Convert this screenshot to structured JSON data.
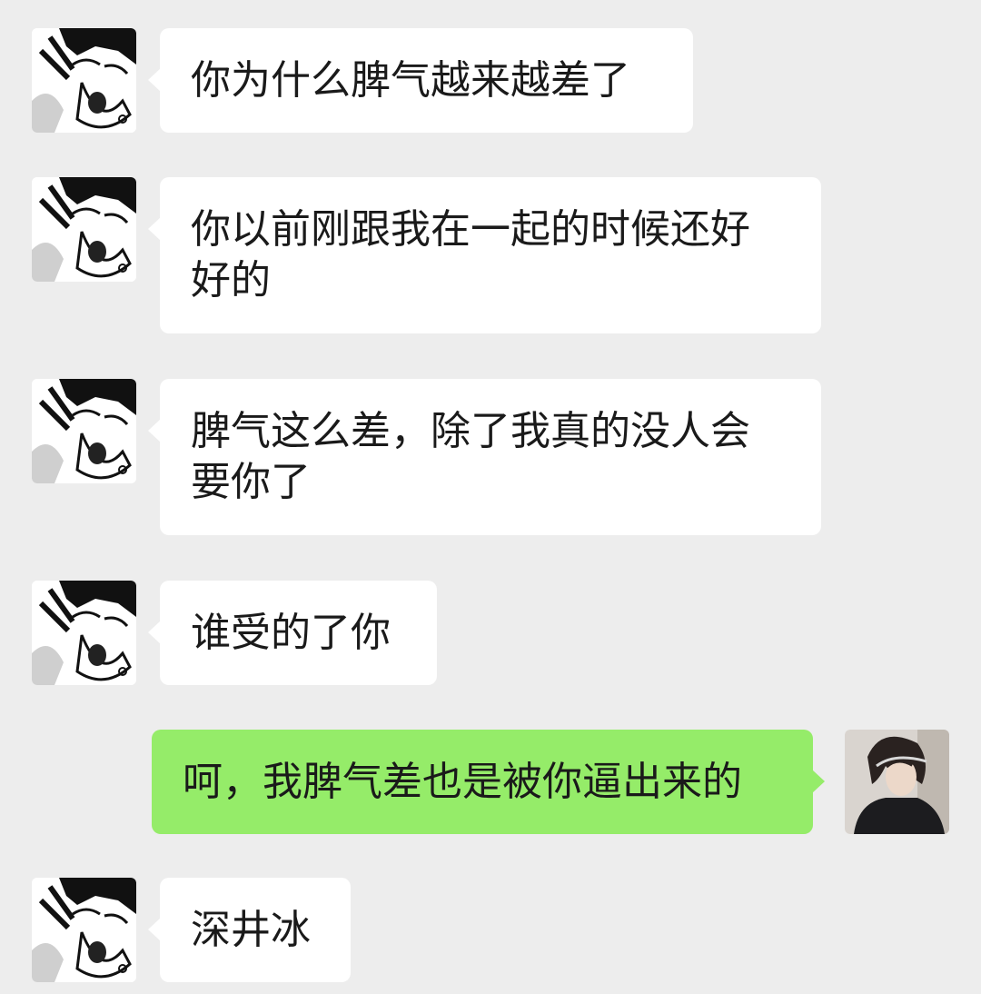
{
  "colors": {
    "background": "#ededed",
    "incoming_bubble": "#ffffff",
    "outgoing_bubble": "#95ec69"
  },
  "messages": [
    {
      "side": "left",
      "avatar": "manga-character-avatar-icon",
      "text": "你为什么脾气越来越差了"
    },
    {
      "side": "left",
      "avatar": "manga-character-avatar-icon",
      "text": "你以前刚跟我在一起的时候还好\n好的"
    },
    {
      "side": "left",
      "avatar": "manga-character-avatar-icon",
      "text": "脾气这么差，除了我真的没人会\n要你了"
    },
    {
      "side": "left",
      "avatar": "manga-character-avatar-icon",
      "text": "谁受的了你"
    },
    {
      "side": "right",
      "avatar": "girl-photo-avatar-icon",
      "text": "呵，我脾气差也是被你逼出来的"
    },
    {
      "side": "left",
      "avatar": "manga-character-avatar-icon",
      "text": "深井冰"
    }
  ]
}
